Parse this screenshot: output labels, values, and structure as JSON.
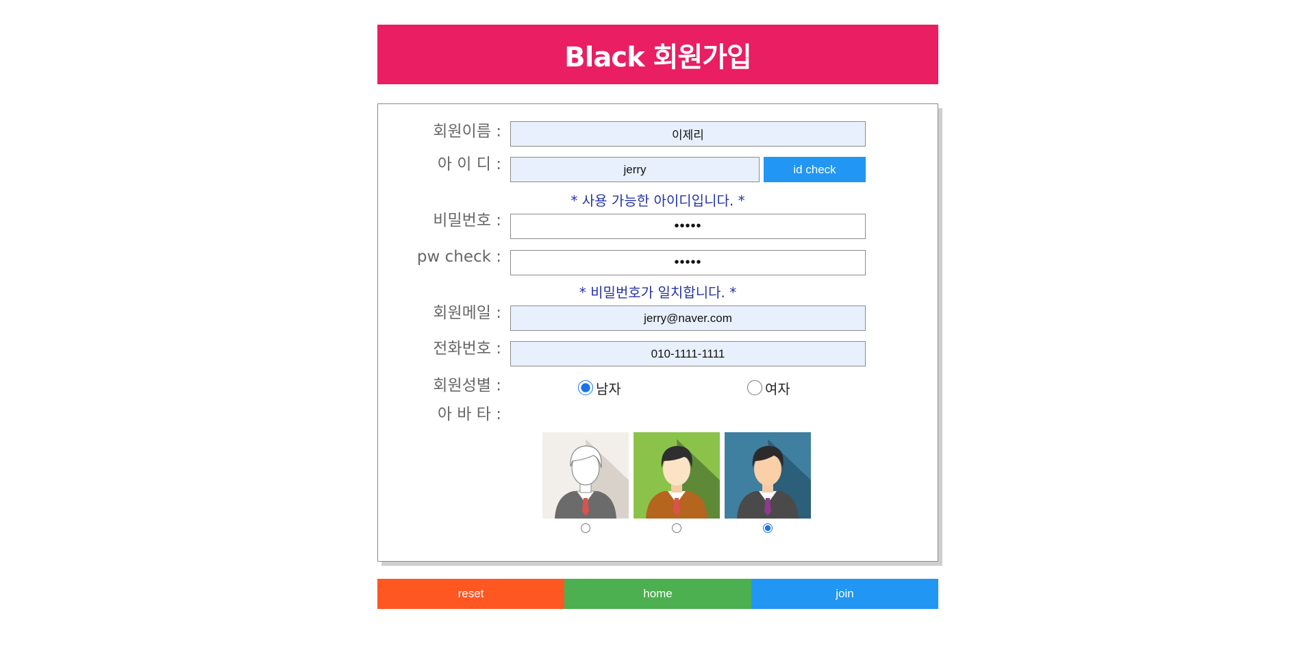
{
  "header": {
    "title": "Black 회원가입"
  },
  "form": {
    "name": {
      "label": "회원이름 :",
      "value": "이제리"
    },
    "id": {
      "label": "아 이 디 :",
      "value": "jerry",
      "check_button": "id check",
      "message": "* 사용 가능한 아이디입니다. *"
    },
    "password": {
      "label": "비밀번호 :",
      "value": "•••••"
    },
    "pw_check": {
      "label": "pw check :",
      "value": "•••••",
      "message": "* 비밀번호가 일치합니다. *"
    },
    "email": {
      "label": "회원메일 :",
      "value": "jerry@naver.com"
    },
    "phone": {
      "label": "전화번호 :",
      "value": "010-1111-1111"
    },
    "gender": {
      "label": "회원성별 :",
      "options": [
        "남자",
        "여자"
      ],
      "selected": "남자"
    },
    "avatar": {
      "label": "아 바 타 :",
      "options": [
        "avatar-white-icon",
        "avatar-green-icon",
        "avatar-blue-icon"
      ],
      "selected_index": 2
    }
  },
  "buttons": {
    "reset": "reset",
    "home": "home",
    "join": "join"
  },
  "colors": {
    "header": "#e91e63",
    "reset": "#ff5722",
    "home": "#4caf50",
    "join": "#2196f3",
    "message": "#2433a6",
    "filled_field": "#e8f0fe"
  }
}
